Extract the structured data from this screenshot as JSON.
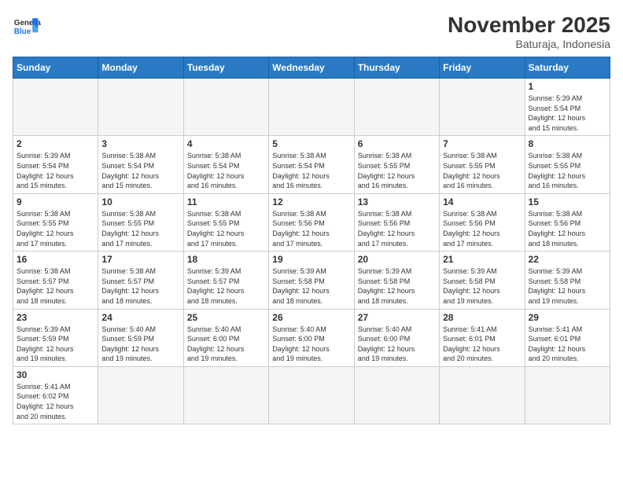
{
  "logo": {
    "text_general": "General",
    "text_blue": "Blue"
  },
  "header": {
    "month_year": "November 2025",
    "location": "Baturaja, Indonesia"
  },
  "days_of_week": [
    "Sunday",
    "Monday",
    "Tuesday",
    "Wednesday",
    "Thursday",
    "Friday",
    "Saturday"
  ],
  "weeks": [
    [
      {
        "day": "",
        "empty": true
      },
      {
        "day": "",
        "empty": true
      },
      {
        "day": "",
        "empty": true
      },
      {
        "day": "",
        "empty": true
      },
      {
        "day": "",
        "empty": true
      },
      {
        "day": "",
        "empty": true
      },
      {
        "day": "1",
        "sunrise": "5:39 AM",
        "sunset": "5:54 PM",
        "daylight": "12 hours and 15 minutes."
      }
    ],
    [
      {
        "day": "2",
        "sunrise": "5:39 AM",
        "sunset": "5:54 PM",
        "daylight": "12 hours and 15 minutes."
      },
      {
        "day": "3",
        "sunrise": "5:38 AM",
        "sunset": "5:54 PM",
        "daylight": "12 hours and 15 minutes."
      },
      {
        "day": "4",
        "sunrise": "5:38 AM",
        "sunset": "5:54 PM",
        "daylight": "12 hours and 16 minutes."
      },
      {
        "day": "5",
        "sunrise": "5:38 AM",
        "sunset": "5:54 PM",
        "daylight": "12 hours and 16 minutes."
      },
      {
        "day": "6",
        "sunrise": "5:38 AM",
        "sunset": "5:55 PM",
        "daylight": "12 hours and 16 minutes."
      },
      {
        "day": "7",
        "sunrise": "5:38 AM",
        "sunset": "5:55 PM",
        "daylight": "12 hours and 16 minutes."
      },
      {
        "day": "8",
        "sunrise": "5:38 AM",
        "sunset": "5:55 PM",
        "daylight": "12 hours and 16 minutes."
      }
    ],
    [
      {
        "day": "9",
        "sunrise": "5:38 AM",
        "sunset": "5:55 PM",
        "daylight": "12 hours and 17 minutes."
      },
      {
        "day": "10",
        "sunrise": "5:38 AM",
        "sunset": "5:55 PM",
        "daylight": "12 hours and 17 minutes."
      },
      {
        "day": "11",
        "sunrise": "5:38 AM",
        "sunset": "5:55 PM",
        "daylight": "12 hours and 17 minutes."
      },
      {
        "day": "12",
        "sunrise": "5:38 AM",
        "sunset": "5:56 PM",
        "daylight": "12 hours and 17 minutes."
      },
      {
        "day": "13",
        "sunrise": "5:38 AM",
        "sunset": "5:56 PM",
        "daylight": "12 hours and 17 minutes."
      },
      {
        "day": "14",
        "sunrise": "5:38 AM",
        "sunset": "5:56 PM",
        "daylight": "12 hours and 17 minutes."
      },
      {
        "day": "15",
        "sunrise": "5:38 AM",
        "sunset": "5:56 PM",
        "daylight": "12 hours and 18 minutes."
      }
    ],
    [
      {
        "day": "16",
        "sunrise": "5:38 AM",
        "sunset": "5:57 PM",
        "daylight": "12 hours and 18 minutes."
      },
      {
        "day": "17",
        "sunrise": "5:38 AM",
        "sunset": "5:57 PM",
        "daylight": "12 hours and 18 minutes."
      },
      {
        "day": "18",
        "sunrise": "5:39 AM",
        "sunset": "5:57 PM",
        "daylight": "12 hours and 18 minutes."
      },
      {
        "day": "19",
        "sunrise": "5:39 AM",
        "sunset": "5:58 PM",
        "daylight": "12 hours and 18 minutes."
      },
      {
        "day": "20",
        "sunrise": "5:39 AM",
        "sunset": "5:58 PM",
        "daylight": "12 hours and 18 minutes."
      },
      {
        "day": "21",
        "sunrise": "5:39 AM",
        "sunset": "5:58 PM",
        "daylight": "12 hours and 19 minutes."
      },
      {
        "day": "22",
        "sunrise": "5:39 AM",
        "sunset": "5:58 PM",
        "daylight": "12 hours and 19 minutes."
      }
    ],
    [
      {
        "day": "23",
        "sunrise": "5:39 AM",
        "sunset": "5:59 PM",
        "daylight": "12 hours and 19 minutes."
      },
      {
        "day": "24",
        "sunrise": "5:40 AM",
        "sunset": "5:59 PM",
        "daylight": "12 hours and 19 minutes."
      },
      {
        "day": "25",
        "sunrise": "5:40 AM",
        "sunset": "6:00 PM",
        "daylight": "12 hours and 19 minutes."
      },
      {
        "day": "26",
        "sunrise": "5:40 AM",
        "sunset": "6:00 PM",
        "daylight": "12 hours and 19 minutes."
      },
      {
        "day": "27",
        "sunrise": "5:40 AM",
        "sunset": "6:00 PM",
        "daylight": "12 hours and 19 minutes."
      },
      {
        "day": "28",
        "sunrise": "5:41 AM",
        "sunset": "6:01 PM",
        "daylight": "12 hours and 20 minutes."
      },
      {
        "day": "29",
        "sunrise": "5:41 AM",
        "sunset": "6:01 PM",
        "daylight": "12 hours and 20 minutes."
      }
    ],
    [
      {
        "day": "30",
        "sunrise": "5:41 AM",
        "sunset": "6:02 PM",
        "daylight": "12 hours and 20 minutes."
      },
      {
        "day": "",
        "empty": true
      },
      {
        "day": "",
        "empty": true
      },
      {
        "day": "",
        "empty": true
      },
      {
        "day": "",
        "empty": true
      },
      {
        "day": "",
        "empty": true
      },
      {
        "day": "",
        "empty": true
      }
    ]
  ],
  "labels": {
    "sunrise": "Sunrise:",
    "sunset": "Sunset:",
    "daylight": "Daylight:"
  }
}
